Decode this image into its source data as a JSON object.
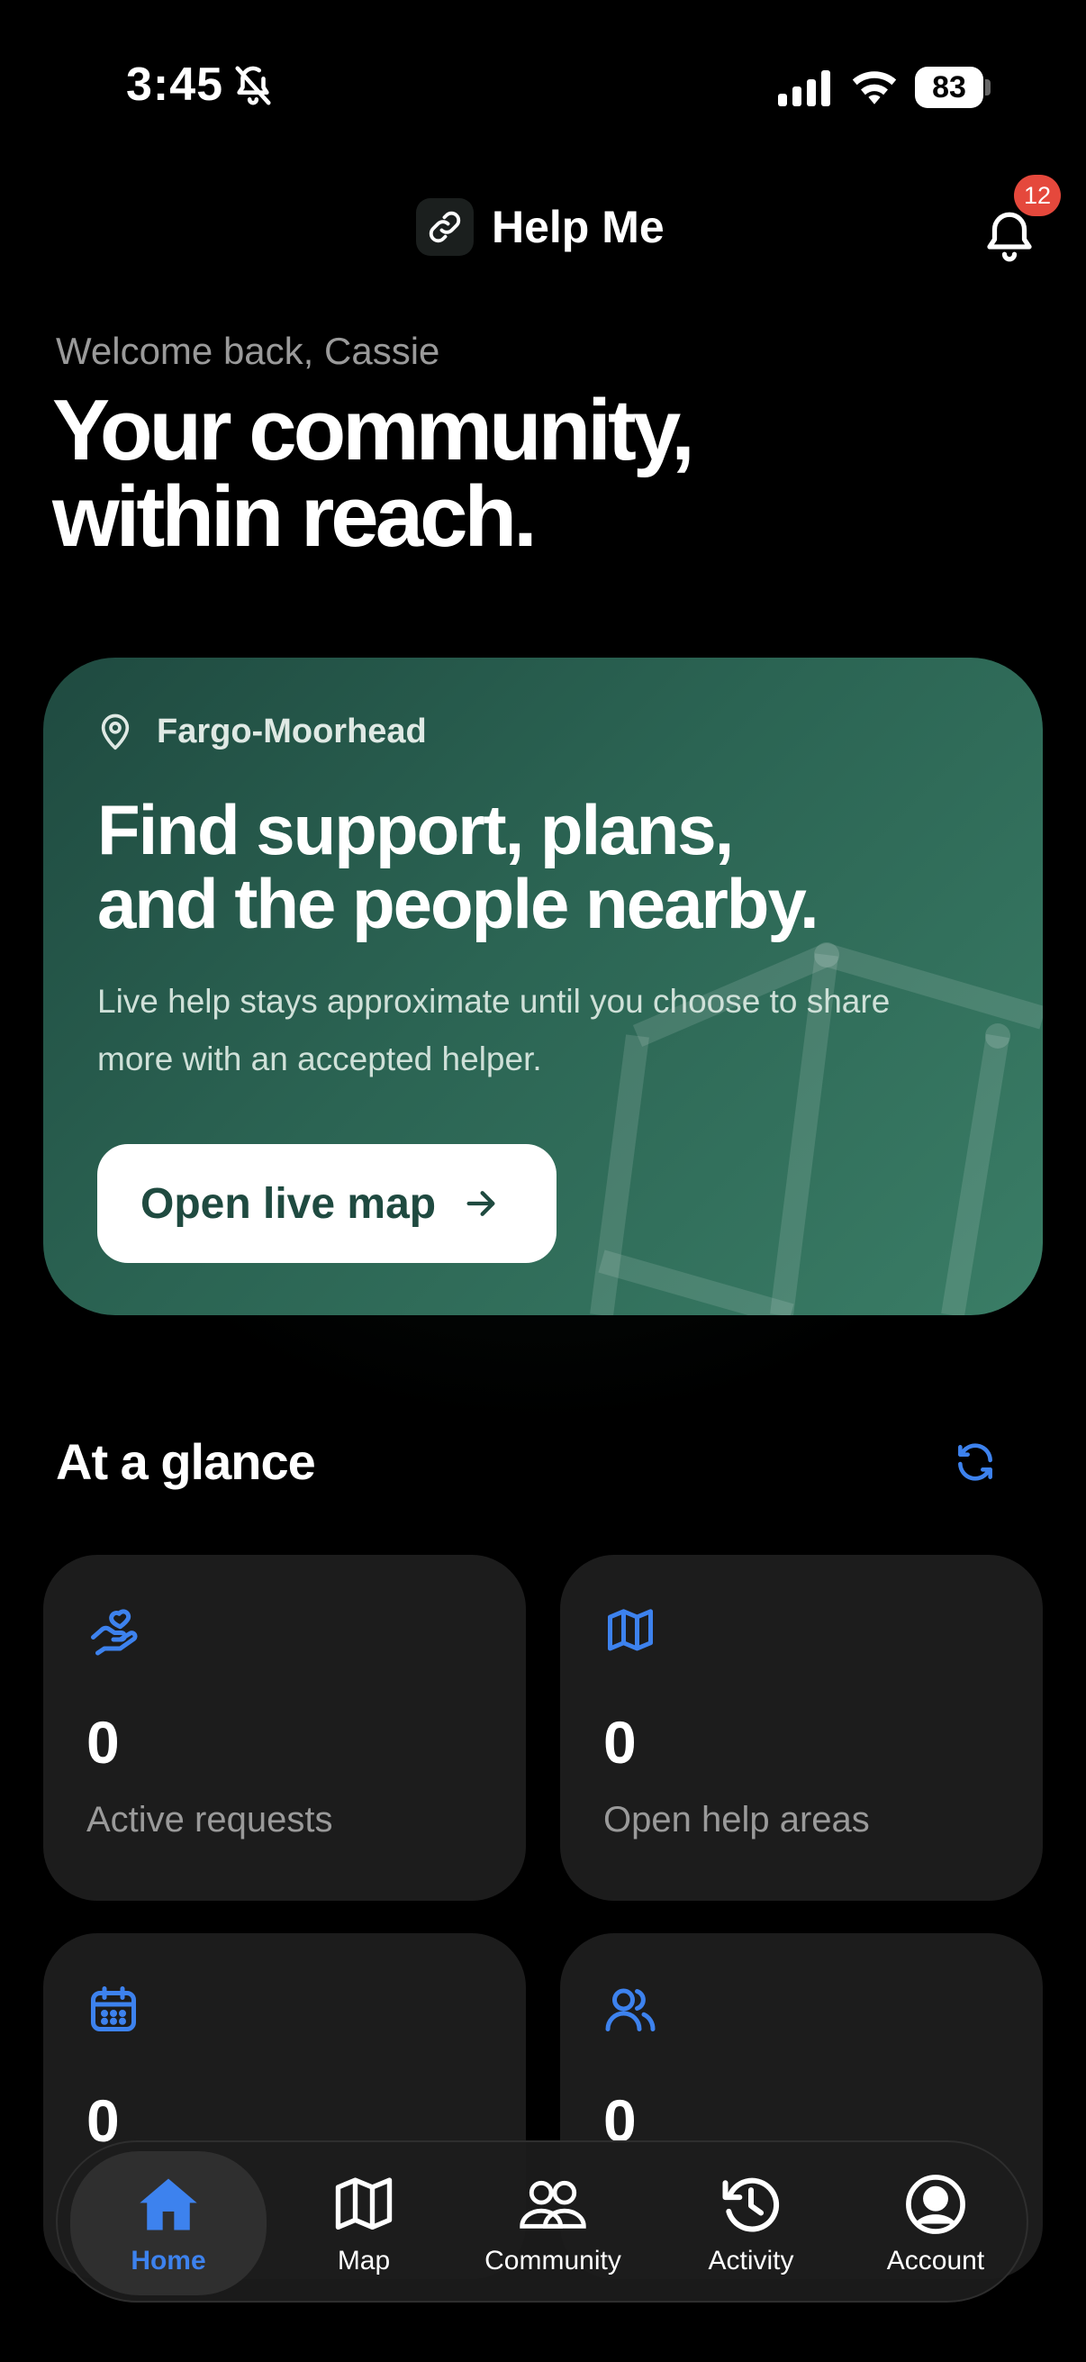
{
  "status_bar": {
    "time": "3:45",
    "battery": "83"
  },
  "header": {
    "brand_name": "Help Me",
    "notification_count": "12"
  },
  "welcome": {
    "greeting": "Welcome back, Cassie",
    "headline_line1": "Your community,",
    "headline_line2": "within reach."
  },
  "hero": {
    "location": "Fargo-Moorhead",
    "title_line1": "Find support, plans,",
    "title_line2": "and the people nearby.",
    "description": "Live help stays approximate until you choose to share more with an accepted helper.",
    "button_label": "Open live map"
  },
  "glance": {
    "title": "At a glance",
    "cards": [
      {
        "value": "0",
        "label": "Active requests",
        "icon": "helping-hand-icon"
      },
      {
        "value": "0",
        "label": "Open help areas",
        "icon": "map-icon"
      },
      {
        "value": "0",
        "label": "",
        "icon": "calendar-icon"
      },
      {
        "value": "0",
        "label": "",
        "icon": "people-icon"
      }
    ]
  },
  "tabs": [
    {
      "label": "Home",
      "icon": "home-icon",
      "active": true
    },
    {
      "label": "Map",
      "icon": "map-icon"
    },
    {
      "label": "Community",
      "icon": "community-icon"
    },
    {
      "label": "Activity",
      "icon": "history-icon"
    },
    {
      "label": "Account",
      "icon": "account-icon"
    }
  ],
  "colors": {
    "accent": "#3d82ee",
    "badge": "#e5483c",
    "hero_start": "#1f4a40",
    "hero_end": "#3a7d66",
    "card": "#1c1c1c"
  }
}
